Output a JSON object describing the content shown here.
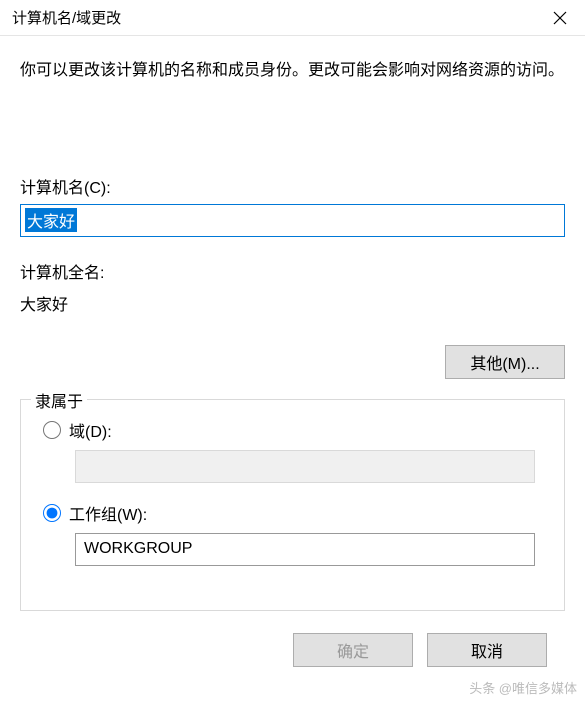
{
  "titlebar": {
    "title": "计算机名/域更改"
  },
  "description": "你可以更改该计算机的名称和成员身份。更改可能会影响对网络资源的访问。",
  "computerName": {
    "label": "计算机名(C):",
    "value": "大家好"
  },
  "fullName": {
    "label": "计算机全名:",
    "value": "大家好"
  },
  "moreButton": "其他(M)...",
  "memberOf": {
    "title": "隶属于",
    "domain": {
      "label": "域(D):",
      "value": "",
      "selected": false
    },
    "workgroup": {
      "label": "工作组(W):",
      "value": "WORKGROUP",
      "selected": true
    }
  },
  "buttons": {
    "ok": "确定",
    "cancel": "取消"
  },
  "watermark": "头条 @唯信多媒体"
}
